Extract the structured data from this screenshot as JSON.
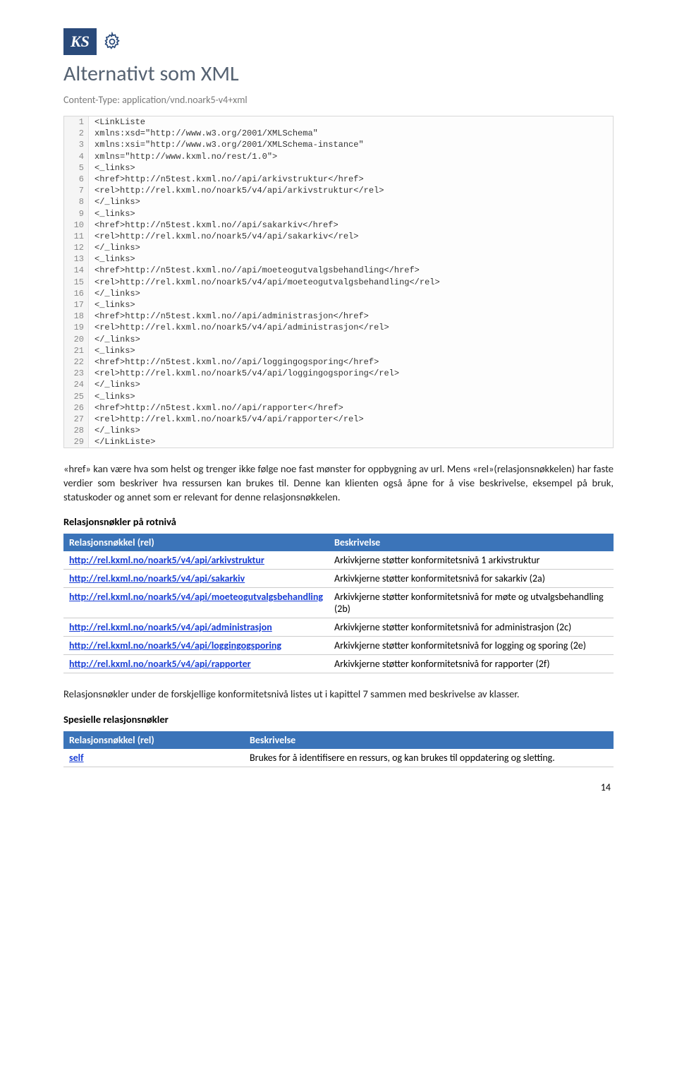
{
  "header": {
    "logo_text": "KS",
    "title": "Alternativt som XML",
    "content_type": "Content-Type: application/vnd.noark5-v4+xml"
  },
  "code_lines": [
    "<LinkListe",
    "xmlns:xsd=\"http://www.w3.org/2001/XMLSchema\"",
    "xmlns:xsi=\"http://www.w3.org/2001/XMLSchema-instance\"",
    "xmlns=\"http://www.kxml.no/rest/1.0\">",
    "<_links>",
    "<href>http://n5test.kxml.no//api/arkivstruktur</href>",
    "<rel>http://rel.kxml.no/noark5/v4/api/arkivstruktur</rel>",
    "</_links>",
    "<_links>",
    "<href>http://n5test.kxml.no//api/sakarkiv</href>",
    "<rel>http://rel.kxml.no/noark5/v4/api/sakarkiv</rel>",
    "</_links>",
    "<_links>",
    "<href>http://n5test.kxml.no//api/moeteogutvalgsbehandling</href>",
    "<rel>http://rel.kxml.no/noark5/v4/api/moeteogutvalgsbehandling</rel>",
    "</_links>",
    "<_links>",
    "<href>http://n5test.kxml.no//api/administrasjon</href>",
    "<rel>http://rel.kxml.no/noark5/v4/api/administrasjon</rel>",
    "</_links>",
    "<_links>",
    "<href>http://n5test.kxml.no//api/loggingogsporing</href>",
    "<rel>http://rel.kxml.no/noark5/v4/api/loggingogsporing</rel>",
    "</_links>",
    "<_links>",
    "<href>http://n5test.kxml.no//api/rapporter</href>",
    "<rel>http://rel.kxml.no/noark5/v4/api/rapporter</rel>",
    "</_links>",
    "</LinkListe>"
  ],
  "paragraph1": "«href» kan være hva som helst og trenger ikke følge noe fast mønster for oppbygning av url. Mens «rel»(relasjonsnøkkelen) har faste verdier som beskriver hva ressursen kan brukes til. Denne kan klienten også åpne for å vise beskrivelse, eksempel på bruk, statuskoder og annet som er relevant for denne relasjonsnøkkelen.",
  "section1_title": "Relasjonsnøkler på rotnivå",
  "table1": {
    "headers": {
      "rel": "Relasjonsnøkkel (rel)",
      "desc": "Beskrivelse"
    },
    "rows": [
      {
        "rel": "http://rel.kxml.no/noark5/v4/api/arkivstruktur",
        "desc": "Arkivkjerne støtter konformitetsnivå 1 arkivstruktur"
      },
      {
        "rel": "http://rel.kxml.no/noark5/v4/api/sakarkiv",
        "desc": "Arkivkjerne støtter konformitetsnivå for sakarkiv (2a)"
      },
      {
        "rel": "http://rel.kxml.no/noark5/v4/api/moeteogutvalgsbehandling",
        "desc": "Arkivkjerne støtter konformitetsnivå for møte og utvalgsbehandling (2b)"
      },
      {
        "rel": "http://rel.kxml.no/noark5/v4/api/administrasjon",
        "desc": "Arkivkjerne støtter konformitetsnivå for administrasjon (2c)"
      },
      {
        "rel": "http://rel.kxml.no/noark5/v4/api/loggingogsporing",
        "desc": "Arkivkjerne støtter konformitetsnivå for logging og sporing (2e)"
      },
      {
        "rel": "http://rel.kxml.no/noark5/v4/api/rapporter",
        "desc": "Arkivkjerne støtter konformitetsnivå for rapporter (2f)"
      }
    ]
  },
  "paragraph2": "Relasjonsnøkler under de forskjellige konformitetsnivå listes ut i kapittel 7 sammen med beskrivelse av klasser.",
  "section2_title": "Spesielle relasjonsnøkler",
  "table2": {
    "headers": {
      "rel": "Relasjonsnøkkel (rel)",
      "desc": "Beskrivelse"
    },
    "rows": [
      {
        "rel": "self",
        "desc": "Brukes for å identifisere en ressurs, og kan brukes til oppdatering og sletting."
      }
    ]
  },
  "page_number": "14"
}
